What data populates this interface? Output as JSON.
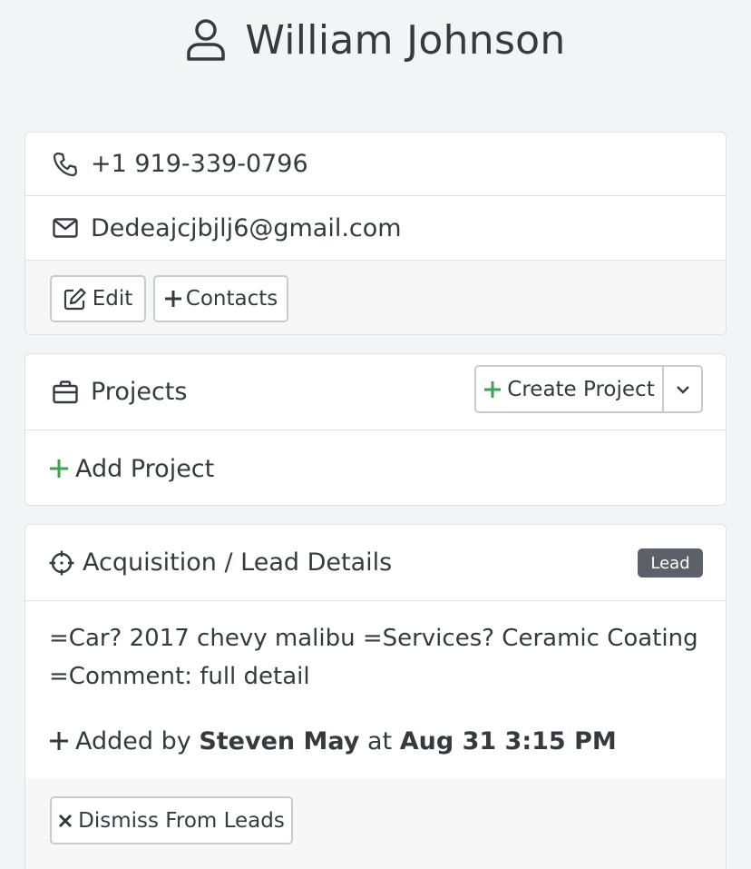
{
  "header": {
    "name": "William Johnson",
    "icon": "user-icon"
  },
  "contact": {
    "phone": "+1 919-339-0796",
    "email": "Dedeajcjbjlj6@gmail.com",
    "edit_label": "Edit",
    "contacts_label": "Contacts"
  },
  "projects": {
    "title": "Projects",
    "create_label": "Create Project",
    "add_label": "Add Project"
  },
  "lead": {
    "title": "Acquisition / Lead Details",
    "badge": "Lead",
    "details_line1": "=Car? 2017 chevy malibu =Services? Ceramic Coating",
    "details_line2": "=Comment: full detail",
    "added_prefix": "Added by",
    "added_by": "Steven May",
    "added_at_word": "at",
    "added_time": "Aug 31 3:15 PM",
    "dismiss_label": "Dismiss From Leads"
  },
  "colors": {
    "accent_green": "#3fa34d",
    "badge_gray": "#5a6168",
    "border": "#dee2e6"
  }
}
